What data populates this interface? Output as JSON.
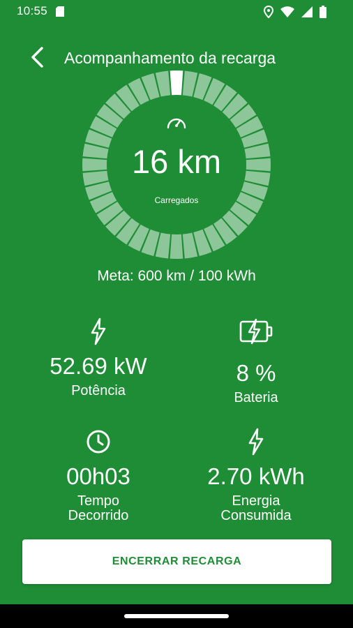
{
  "status_bar": {
    "time": "10:55",
    "icons": [
      "sd-card-icon",
      "location-icon",
      "wifi-icon",
      "signal-icon",
      "battery-icon"
    ]
  },
  "header": {
    "back_icon": "chevron-left-icon",
    "title": "Acompanhamento da recarga"
  },
  "progress": {
    "value": "16 km",
    "caption": "Carregados",
    "icon": "speedometer-icon",
    "segments_total": 40,
    "segments_active": 1,
    "fraction": 0.027
  },
  "goal": "Meta: 600 km / 100 kWh",
  "stats": {
    "power": {
      "icon": "lightning-bolt-icon",
      "value": "52.69 kW",
      "label": "Potência"
    },
    "battery": {
      "icon": "battery-charging-icon",
      "value": "8 %",
      "label": "Bateria"
    },
    "elapsed": {
      "icon": "clock-icon",
      "value": "00h03",
      "label_line1": "Tempo",
      "label_line2": "Decorrido"
    },
    "energy": {
      "icon": "lightning-bolt-icon",
      "value": "2.70 kWh",
      "label_line1": "Energia",
      "label_line2": "Consumida"
    }
  },
  "end_button": "ENCERRAR RECARGA",
  "colors": {
    "background": "#1e8d35",
    "segment_inactive": "#8dc799",
    "segment_active": "#ffffff",
    "button_bg": "#ffffff",
    "button_text": "#1e8d35"
  }
}
